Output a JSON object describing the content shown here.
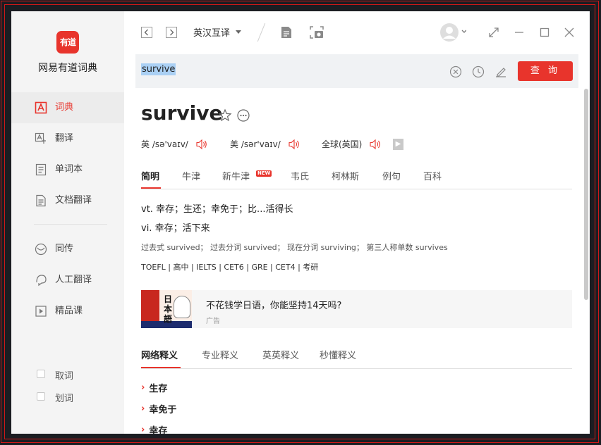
{
  "app": {
    "logo_text": "有道",
    "name": "网易有道词典"
  },
  "sidebar": {
    "items": [
      {
        "label": "词典",
        "icon": "dictionary-icon",
        "active": true
      },
      {
        "label": "翻译",
        "icon": "translate-icon"
      },
      {
        "label": "单词本",
        "icon": "wordbook-icon"
      },
      {
        "label": "文档翻译",
        "icon": "document-icon"
      },
      {
        "label": "同传",
        "icon": "simultaneous-icon"
      },
      {
        "label": "人工翻译",
        "icon": "human-translate-icon"
      },
      {
        "label": "精品课",
        "icon": "course-icon"
      }
    ],
    "checks": [
      {
        "label": "取词",
        "checked": false
      },
      {
        "label": "划词",
        "checked": false
      }
    ]
  },
  "topbar": {
    "lang_mode": "英汉互译"
  },
  "search": {
    "value": "survive",
    "button_label": "查 询"
  },
  "entry": {
    "word": "survive",
    "pron": [
      {
        "label": "英 /sə'vaɪv/"
      },
      {
        "label": "美 /sər'vaɪv/"
      },
      {
        "label": "全球(英国)"
      }
    ],
    "tabs": [
      "简明",
      "牛津",
      "新牛津",
      "韦氏",
      "柯林斯",
      "例句",
      "百科"
    ],
    "new_badge": "NEW",
    "definitions": [
      "vt. 幸存；生还；幸免于；比...活得长",
      "vi. 幸存；活下来"
    ],
    "forms": "过去式 survived；  过去分词 survived；  现在分词 surviving；  第三人称单数 survives",
    "exams": "TOEFL | 高中 | IELTS | CET6 | GRE | CET4 | 考研"
  },
  "ad": {
    "title": "不花钱学日语，你能坚持14天吗?",
    "label": "广告",
    "image_text": "日本語"
  },
  "subtabs": [
    "网络释义",
    "专业释义",
    "英英释义",
    "秒懂释义"
  ],
  "web_defs": [
    "生存",
    "幸免于",
    "幸存"
  ],
  "colors": {
    "accent": "#e8342c",
    "sidebar_bg": "#f4f4f4",
    "search_bg": "#f0f2f4"
  }
}
